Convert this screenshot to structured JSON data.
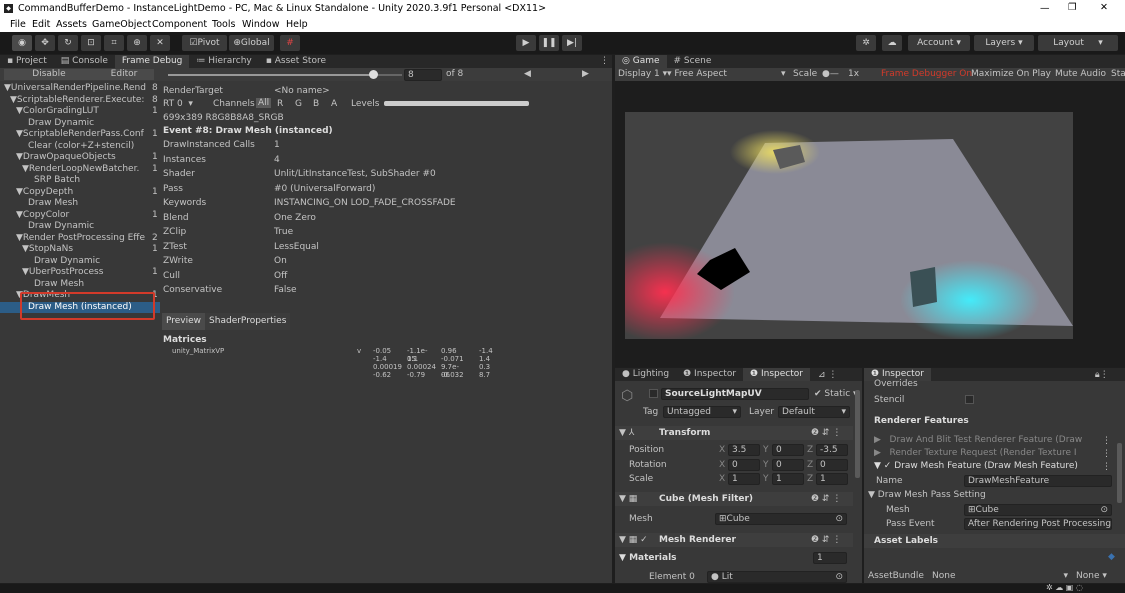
{
  "window": {
    "title": "CommandBufferDemo - InstanceLightDemo - PC, Mac & Linux Standalone - Unity 2020.3.9f1 Personal <DX11>",
    "min": "—",
    "max": "❐",
    "close": "✕"
  },
  "menu": [
    "File",
    "Edit",
    "Assets",
    "GameObject",
    "Component",
    "Tools",
    "Window",
    "Help"
  ],
  "toolbar": {
    "pivot": "Pivot",
    "global": "Global",
    "account": "Account",
    "layers": "Layers",
    "layout": "Layout"
  },
  "leftTabs": {
    "project": "Project",
    "console": "Console",
    "frameDebug": "Frame Debug",
    "hierarchy": "Hierarchy",
    "assetStore": "Asset Store"
  },
  "frameDebug": {
    "disable": "Disable",
    "editor": "Editor",
    "event": "8",
    "of": "of 8",
    "slider": 0.875
  },
  "tree": [
    {
      "t": "▼UniversalRenderPipeline.RenderS",
      "c": "8",
      "i": 0
    },
    {
      "t": "▼ScriptableRenderer.Execute: F",
      "c": "8",
      "i": 1
    },
    {
      "t": "▼ColorGradingLUT",
      "c": "1",
      "i": 2
    },
    {
      "t": "Draw Dynamic",
      "c": "",
      "i": 4
    },
    {
      "t": "▼ScriptableRenderPass.Conf",
      "c": "1",
      "i": 2
    },
    {
      "t": "Clear (color+Z+stencil)",
      "c": "",
      "i": 4
    },
    {
      "t": "▼DrawOpaqueObjects",
      "c": "1",
      "i": 2
    },
    {
      "t": "▼RenderLoopNewBatcher.",
      "c": "1",
      "i": 3
    },
    {
      "t": "SRP Batch",
      "c": "",
      "i": 5
    },
    {
      "t": "▼CopyDepth",
      "c": "1",
      "i": 2
    },
    {
      "t": "Draw Mesh",
      "c": "",
      "i": 4
    },
    {
      "t": "▼CopyColor",
      "c": "1",
      "i": 2
    },
    {
      "t": "Draw Dynamic",
      "c": "",
      "i": 4
    },
    {
      "t": "▼Render PostProcessing Effe",
      "c": "2",
      "i": 2
    },
    {
      "t": "▼StopNaNs",
      "c": "1",
      "i": 3
    },
    {
      "t": "Draw Dynamic",
      "c": "",
      "i": 5
    },
    {
      "t": "▼UberPostProcess",
      "c": "1",
      "i": 3
    },
    {
      "t": "Draw Mesh",
      "c": "",
      "i": 5
    },
    {
      "t": "▼DrawMesh",
      "c": "1",
      "i": 2
    },
    {
      "t": "Draw Mesh (instanced)",
      "c": "",
      "i": 4
    }
  ],
  "renderTarget": {
    "label": "RenderTarget",
    "value": "<No name>",
    "rt": "RT 0",
    "channels": "Channels",
    "all": "All",
    "r": "R",
    "g": "G",
    "b": "B",
    "a": "A",
    "levels": "Levels",
    "format": "699x389 R8G8B8A8_SRGB"
  },
  "event": {
    "title": "Event #8: Draw Mesh (instanced)",
    "rows": [
      [
        "DrawInstanced Calls",
        "1"
      ],
      [
        "Instances",
        "4"
      ],
      [
        "Shader",
        "Unlit/LitInstanceTest, SubShader #0"
      ],
      [
        "Pass",
        "#0 (UniversalForward)"
      ],
      [
        "Keywords",
        "INSTANCING_ON LOD_FADE_CROSSFADE"
      ],
      [
        "Blend",
        "One Zero"
      ],
      [
        "ZClip",
        "True"
      ],
      [
        "ZTest",
        "LessEqual"
      ],
      [
        "ZWrite",
        "On"
      ],
      [
        "Cull",
        "Off"
      ],
      [
        "Conservative",
        "False"
      ]
    ]
  },
  "previewTabs": {
    "preview": "Preview",
    "shader": "ShaderProperties"
  },
  "matrices": {
    "title": "Matrices",
    "name": "unity_MatrixVP",
    "v": "v",
    "rows": [
      [
        "-0.05",
        "-1.1e-05",
        "0.96",
        "-1.4"
      ],
      [
        "-1.4",
        "1.1",
        "-0.071",
        "1.4"
      ],
      [
        "0.00019",
        "0.00024",
        "9.7e-06",
        "0.3"
      ],
      [
        "-0.62",
        "-0.79",
        "-0.032",
        "8.7"
      ]
    ]
  },
  "gameTabs": {
    "game": "Game",
    "scene": "Scene"
  },
  "gameBar": {
    "display": "Display 1",
    "aspect": "Free Aspect",
    "scale": "Scale",
    "scaleVal": "1x",
    "fdOn": "Frame Debugger On",
    "max": "Maximize On Play",
    "mute": "Mute Audio",
    "stats": "Stat"
  },
  "inspTabs": {
    "lighting": "Lighting",
    "insp1": "Inspector",
    "insp2": "Inspector"
  },
  "inspector": {
    "name": "SourceLightMapUV",
    "static": "Static",
    "tagLabel": "Tag",
    "tag": "Untagged",
    "layerLabel": "Layer",
    "layer": "Default",
    "transform": "Transform",
    "position": [
      "Position",
      "3.5",
      "0",
      "-3.5"
    ],
    "rotation": [
      "Rotation",
      "0",
      "0",
      "0"
    ],
    "scale": [
      "Scale",
      "1",
      "1",
      "1"
    ],
    "meshFilter": "Cube (Mesh Filter)",
    "meshLabel": "Mesh",
    "meshVal": "Cube",
    "meshRenderer": "Mesh Renderer",
    "materials": "Materials",
    "matCount": "1",
    "element": "Element 0",
    "elementVal": "Lit"
  },
  "insp2": {
    "tab": "Inspector",
    "overrides": "Overrides",
    "stencil": "Stencil",
    "rf": "Renderer Features",
    "f1": "Draw And Blit Test Renderer Feature (Draw",
    "f2": "Render Texture Request (Render Texture I",
    "f3": "Draw Mesh Feature (Draw Mesh Feature)",
    "nameLabel": "Name",
    "nameVal": "DrawMeshFeature",
    "pass": "Draw Mesh Pass Setting",
    "mesh": "Mesh",
    "meshVal": "Cube",
    "pe": "Pass Event",
    "peVal": "After Rendering Post Processing",
    "assetLabels": "Asset Labels",
    "bundle": "AssetBundle",
    "none1": "None",
    "none2": "None"
  },
  "colors": {
    "accent": "#3a72b0",
    "highlight": "#d23a2a"
  }
}
